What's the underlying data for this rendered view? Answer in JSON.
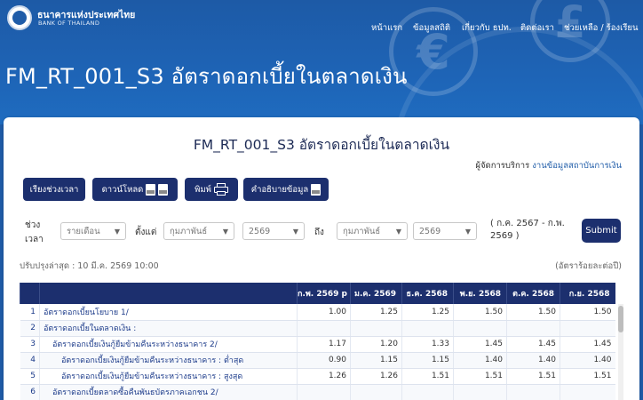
{
  "brand": {
    "name_th": "ธนาคารแห่งประเทศไทย",
    "name_en": "BANK OF THAILAND"
  },
  "nav": [
    {
      "label": "หน้าแรก"
    },
    {
      "label": "ข้อมูลสถิติ"
    },
    {
      "label": "เกี่ยวกับ ธปท."
    },
    {
      "label": "ติดต่อเรา"
    },
    {
      "label": "ช่วยเหลือ / ร้องเรียน"
    }
  ],
  "coins": {
    "c1": "€",
    "c2": "£"
  },
  "page_heading": "FM_RT_001_S3 อัตราดอกเบี้ยในตลาดเงิน",
  "card": {
    "title": "FM_RT_001_S3 อัตราดอกเบี้ยในตลาดเงิน",
    "provider_label": "ผู้จัดการบริการ",
    "provider_link": "งานข้อมูลสถาบันการเงิน"
  },
  "buttons": {
    "sort": "เรียงช่วงเวลา",
    "download": "ดาวน์โหลด",
    "print": "พิมพ์",
    "explain": "คำอธิบายข้อมูล",
    "submit": "Submit"
  },
  "filters": {
    "period_label_1": "ช่วง",
    "period_label_2": "เวลา",
    "period_value": "รายเดือน",
    "from_label": "ตั้งแต่",
    "from_month": "กุมภาพันธ์",
    "from_year": "2569",
    "to_label": "ถึง",
    "to_month": "กุมภาพันธ์",
    "to_year": "2569",
    "range_text": "( ก.ค. 2567 - ก.พ. 2569 )"
  },
  "updated_text": "ปรับปรุงล่าสุด : 10 มี.ค. 2569 10:00",
  "unit_text": "(อัตราร้อยละต่อปี)",
  "table": {
    "headers": [
      "",
      "",
      "ก.พ. 2569 p",
      "ม.ค. 2569",
      "ธ.ค. 2568",
      "พ.ย. 2568",
      "ต.ค. 2568",
      "ก.ย. 2568"
    ],
    "rows": [
      {
        "num": "1",
        "name": "อัตราดอกเบี้ยนโยบาย 1/",
        "indent": 0,
        "values": [
          "1.00",
          "1.25",
          "1.25",
          "1.50",
          "1.50",
          "1.50"
        ]
      },
      {
        "num": "2",
        "name": "อัตราดอกเบี้ยในตลาดเงิน :",
        "indent": 0,
        "values": [
          "",
          "",
          "",
          "",
          "",
          ""
        ]
      },
      {
        "num": "3",
        "name": "อัตราดอกเบี้ยเงินกู้ยืมข้ามคืนระหว่างธนาคาร 2/",
        "indent": 1,
        "values": [
          "1.17",
          "1.20",
          "1.33",
          "1.45",
          "1.45",
          "1.45"
        ]
      },
      {
        "num": "4",
        "name": "อัตราดอกเบี้ยเงินกู้ยืมข้ามคืนระหว่างธนาคาร : ต่ำสุด",
        "indent": 2,
        "values": [
          "0.90",
          "1.15",
          "1.15",
          "1.40",
          "1.40",
          "1.40"
        ]
      },
      {
        "num": "5",
        "name": "อัตราดอกเบี้ยเงินกู้ยืมข้ามคืนระหว่างธนาคาร : สูงสุด",
        "indent": 2,
        "values": [
          "1.26",
          "1.26",
          "1.51",
          "1.51",
          "1.51",
          "1.51"
        ]
      },
      {
        "num": "6",
        "name": "อัตราดอกเบี้ยตลาดซื้อคืนพันธบัตรภาคเอกชน 2/",
        "indent": 1,
        "values": [
          "",
          "",
          "",
          "",
          "",
          ""
        ]
      }
    ]
  }
}
